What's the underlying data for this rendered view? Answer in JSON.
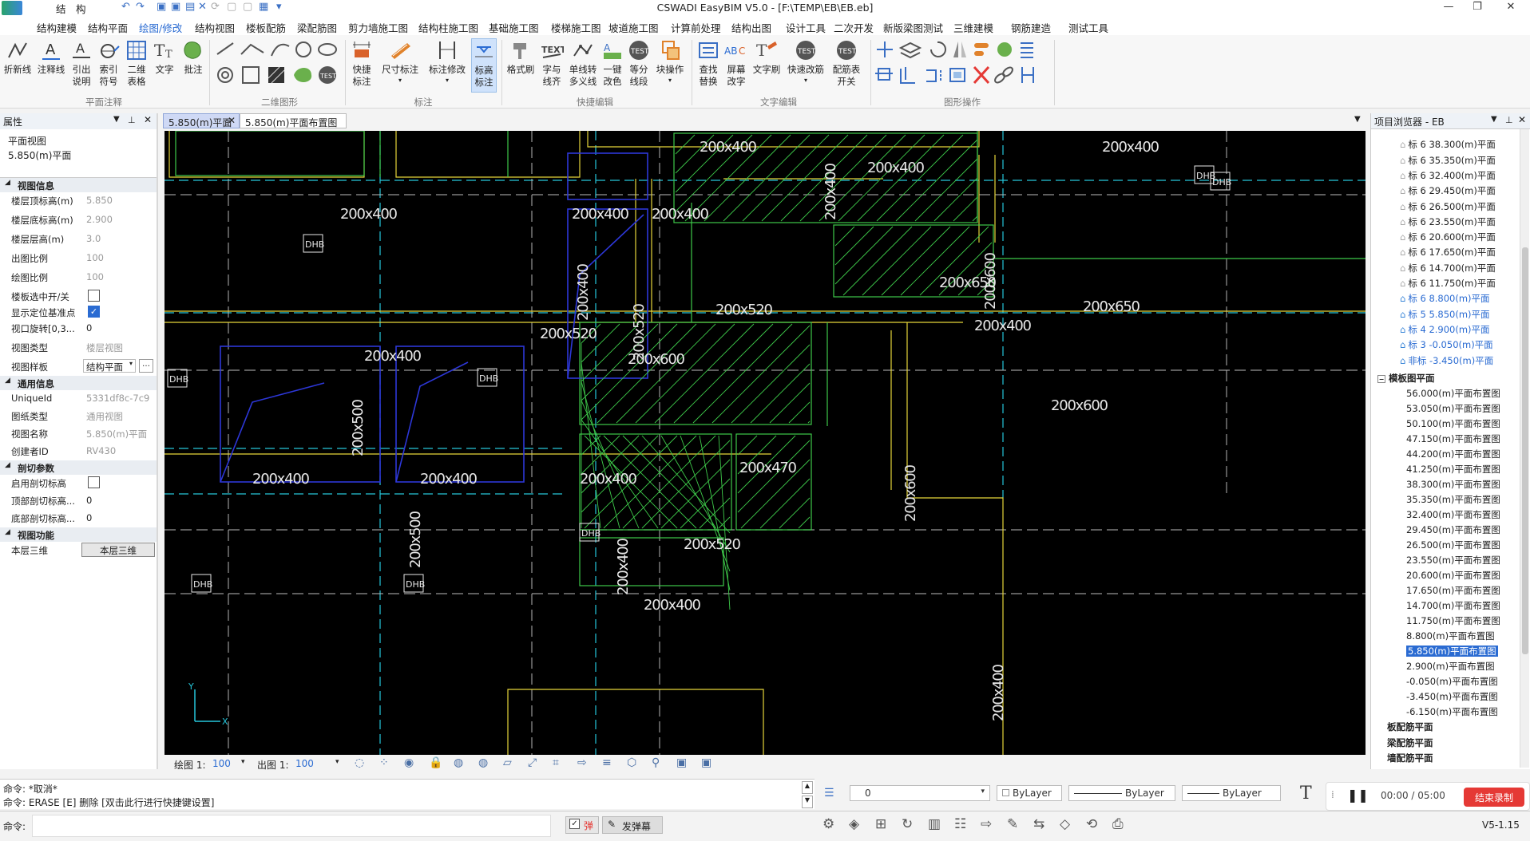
{
  "titlebar": {
    "app_menu": "结　构",
    "title": "CSWADI EasyBIM V5.0 - [F:\\TEMP\\EB\\EB.eb]"
  },
  "menubar": {
    "items": [
      "结构建模",
      "结构平面",
      "绘图/修改",
      "结构视图",
      "楼板配筋",
      "梁配筋图",
      "剪力墙施工图",
      "结构柱施工图",
      "基础施工图",
      "楼梯施工图",
      "坡道施工图",
      "计算前处理",
      "结构出图",
      "设计工具",
      "二次开发",
      "新版梁图测试",
      "三维建模",
      "钢筋建造",
      "测试工具"
    ],
    "active_index": 2
  },
  "ribbon": {
    "buttons": [
      {
        "id": "zhexian",
        "label": "折新线",
        "icon": "polyline-icon"
      },
      {
        "id": "zhushixian",
        "label": "注释线",
        "icon": "annotation-line-icon"
      },
      {
        "id": "yinchu",
        "label": "引出\n说明",
        "icon": "leader-icon"
      },
      {
        "id": "suoyin",
        "label": "索引\n符号",
        "icon": "index-symbol-icon"
      },
      {
        "id": "erweibiaoge",
        "label": "二维\n表格",
        "icon": "table-icon"
      },
      {
        "id": "wenzi",
        "label": "文字",
        "icon": "text-icon"
      },
      {
        "id": "pizhu",
        "label": "批注",
        "icon": "comment-icon"
      },
      {
        "id": "kuaijie",
        "label": "快捷\n标注",
        "icon": "quick-dimension-icon"
      },
      {
        "id": "chicun",
        "label": "尺寸标注",
        "icon": "dimension-icon"
      },
      {
        "id": "biaozhu",
        "label": "标注修改",
        "icon": "dimension-edit-icon"
      },
      {
        "id": "biaogao",
        "label": "标高\n标注",
        "icon": "elevation-icon"
      },
      {
        "id": "geshishua",
        "label": "格式刷",
        "icon": "format-brush-icon"
      },
      {
        "id": "ziyuxian",
        "label": "字与\n线齐",
        "icon": "text-align-icon"
      },
      {
        "id": "danxian",
        "label": "单线转\n多义线",
        "icon": "line-convert-icon"
      },
      {
        "id": "yijian",
        "label": "一键\n改色",
        "icon": "recolor-icon"
      },
      {
        "id": "dengfen",
        "label": "等分\n线段",
        "icon": "divide-icon"
      },
      {
        "id": "kuaicaozuo",
        "label": "块操作",
        "icon": "block-icon"
      },
      {
        "id": "chazhao",
        "label": "查找\n替换",
        "icon": "find-replace-icon"
      },
      {
        "id": "pingmu",
        "label": "屏幕\n改字",
        "icon": "screen-edit-icon"
      },
      {
        "id": "wenzishua",
        "label": "文字刷",
        "icon": "text-brush-icon"
      },
      {
        "id": "kuaisu",
        "label": "快速改筋",
        "icon": "rebar-edit-icon"
      },
      {
        "id": "peijinbiao",
        "label": "配筋表\n开关",
        "icon": "rebar-table-icon"
      }
    ],
    "groups": [
      "平面注释",
      "二维图形",
      "标注",
      "快捷编辑",
      "文字编辑",
      "图形操作"
    ]
  },
  "left_panel": {
    "title": "属性",
    "view_type_label": "平面视图",
    "view_name_label": "5.850(m)平面",
    "sections": [
      {
        "title": "视图信息",
        "rows": [
          {
            "k": "楼层顶标高(m)",
            "v": "5.850"
          },
          {
            "k": "楼层底标高(m)",
            "v": "2.900"
          },
          {
            "k": "楼层层高(m)",
            "v": "3.0"
          },
          {
            "k": "出图比例",
            "v": "100"
          },
          {
            "k": "绘图比例",
            "v": "100"
          },
          {
            "k": "楼板选中开/关",
            "v": ""
          },
          {
            "k": "显示定位基准点",
            "v": ""
          },
          {
            "k": "视口旋转[0,3...",
            "v": "0"
          },
          {
            "k": "视图类型",
            "v": "楼层视图"
          },
          {
            "k": "视图样板",
            "v": "结构平面"
          }
        ]
      },
      {
        "title": "通用信息",
        "rows": [
          {
            "k": "UniqueId",
            "v": "5331df8c-7c9"
          },
          {
            "k": "图纸类型",
            "v": "通用视图"
          },
          {
            "k": "视图名称",
            "v": "5.850(m)平面"
          },
          {
            "k": "创建者ID",
            "v": "RV430"
          }
        ]
      },
      {
        "title": "剖切参数",
        "rows": [
          {
            "k": "启用剖切标高",
            "v": ""
          },
          {
            "k": "顶部剖切标高...",
            "v": "0"
          },
          {
            "k": "底部剖切标高...",
            "v": "0"
          }
        ]
      },
      {
        "title": "视图功能",
        "rows": [
          {
            "k": "本层三维",
            "v": "本层三维"
          }
        ]
      }
    ]
  },
  "doc_tabs": [
    "5.850(m)平面",
    "5.850(m)平面布置图"
  ],
  "canvas": {
    "labels": [
      "200x400",
      "200x400",
      "200x400",
      "200x400",
      "200x400",
      "200x650",
      "200x650",
      "200x600",
      "200x600",
      "200x520",
      "200x400",
      "200x520",
      "200x470",
      "200x600",
      "200x400",
      "200x500",
      "200x400",
      "200x520",
      "200x400",
      "200x400",
      "200x500",
      "200x400",
      "200x400",
      "200x400",
      "200x400",
      "200x600",
      "200x400",
      "200x520",
      "200x400"
    ],
    "dhb": "DHB"
  },
  "canvas_status": {
    "draw_scale_label": "绘图 1:",
    "draw_scale": "100",
    "out_scale_label": "出图 1:",
    "out_scale": "100"
  },
  "right_panel": {
    "title": "项目浏览器 - EB",
    "items": [
      "标 6 38.300(m)平面",
      "标 6 35.350(m)平面",
      "标 6 32.400(m)平面",
      "标 6 29.450(m)平面",
      "标 6 26.500(m)平面",
      "标 6 23.550(m)平面",
      "标 6 20.600(m)平面",
      "标 6 17.650(m)平面",
      "标 6 14.700(m)平面",
      "标 6 11.750(m)平面",
      "标 6 8.800(m)平面",
      "标 5 5.850(m)平面",
      "标 4 2.900(m)平面",
      "标 3 -0.050(m)平面",
      "非标 -3.450(m)平面"
    ],
    "group": "模板图平面",
    "layout_items": [
      "56.000(m)平面布置图",
      "53.050(m)平面布置图",
      "50.100(m)平面布置图",
      "47.150(m)平面布置图",
      "44.200(m)平面布置图",
      "41.250(m)平面布置图",
      "38.300(m)平面布置图",
      "35.350(m)平面布置图",
      "32.400(m)平面布置图",
      "29.450(m)平面布置图",
      "26.500(m)平面布置图",
      "23.550(m)平面布置图",
      "20.600(m)平面布置图",
      "17.650(m)平面布置图",
      "14.700(m)平面布置图",
      "11.750(m)平面布置图",
      "8.800(m)平面布置图",
      "5.850(m)平面布置图",
      "2.900(m)平面布置图",
      "-0.050(m)平面布置图",
      "-3.450(m)平面布置图",
      "-6.150(m)平面布置图"
    ],
    "selected_index": 17,
    "other_groups": [
      "板配筋平面",
      "梁配筋平面",
      "墙配筋平面"
    ]
  },
  "command": {
    "line1": "命令: *取消*",
    "line2": "命令: ERASE [E] 删除 [双击此行进行快捷键设置]",
    "prompt": "命令:"
  },
  "props_bar": {
    "layer": "0",
    "color": "ByLayer",
    "linetype": "ByLayer",
    "lineweight": "ByLayer"
  },
  "recorder": {
    "time": "00:00 / 05:00",
    "stop_label": "结束录制"
  },
  "bottombar": {
    "toggle1": "弹",
    "toggle2": "发弹幕",
    "version": "V5-1.15"
  }
}
